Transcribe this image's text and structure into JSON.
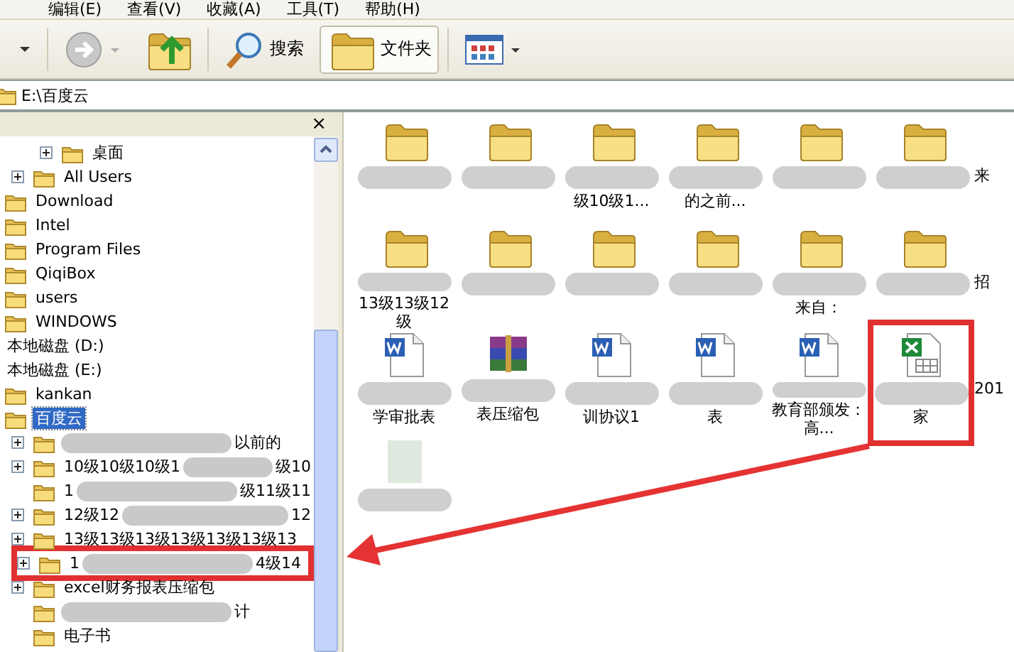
{
  "menu": [
    {
      "label": "编辑(E)"
    },
    {
      "label": "查看(V)"
    },
    {
      "label": "收藏(A)"
    },
    {
      "label": "工具(T)"
    },
    {
      "label": "帮助(H)"
    }
  ],
  "toolbar": [
    {
      "kind": "back"
    },
    {
      "kind": "forward",
      "disabled": true
    },
    {
      "kind": "up"
    },
    {
      "kind": "search",
      "label": "搜索",
      "selected": false
    },
    {
      "kind": "folders",
      "label": "文件夹",
      "selected": true
    },
    {
      "kind": "views"
    }
  ],
  "address": {
    "path": "E:\\百度云"
  },
  "tree": {
    "close": "×",
    "items": [
      {
        "children": [
          {
            "children": [
              {
                "children": [
                  {
                    "label": "桌面",
                    "kind": "folder",
                    "expanded": false
                  }
                ]
              },
              {
                "label": "All Users",
                "kind": "folder",
                "expanded": false
              }
            ]
          },
          {
            "label": "Download",
            "kind": "folder"
          },
          {
            "label": "Intel",
            "kind": "folder"
          },
          {
            "label": "Program Files",
            "kind": "folder"
          },
          {
            "label": "QiqiBox",
            "kind": "folder"
          },
          {
            "label": "users",
            "kind": "folder"
          },
          {
            "label": "WINDOWS",
            "kind": "folder"
          }
        ]
      },
      {
        "label": "本地磁盘 (D:)"
      },
      {
        "label": "本地磁盘 (E:)",
        "children": [
          {
            "label": "kankan",
            "kind": "folder",
            "selected": false
          },
          {
            "label": "百度云",
            "kind": "folder",
            "selected": true,
            "children": [
              {
                "kind": "folder",
                "expanded": false,
                "blurred": true,
                "tail": "以前的",
                "selected": false
              },
              {
                "kind": "folder",
                "expanded": false,
                "label": "10级10级10级1",
                "blurred": true,
                "tail": "级10",
                "selected": false
              },
              {
                "kind": "folder",
                "label": "1",
                "blurred": true,
                "tail": "级11级11",
                "selected": false
              },
              {
                "kind": "folder",
                "expanded": false,
                "label": "12级12",
                "blurred": true,
                "tail": "12",
                "selected": false
              },
              {
                "kind": "folder",
                "expanded": false,
                "label": "13级13级13级13级13级13级13",
                "selected": false
              },
              {
                "kind": "folder",
                "expanded": false,
                "label": "1",
                "blurred": true,
                "tail": "4级14",
                "highlighted": true,
                "selected": false
              },
              {
                "kind": "folder",
                "expanded": false,
                "label": "excel财务报表压缩包",
                "selected": false
              },
              {
                "kind": "folder",
                "blurred": true,
                "tail": "计",
                "selected": false
              },
              {
                "kind": "folder",
                "label": "电子书",
                "selected": false
              }
            ]
          }
        ]
      }
    ]
  },
  "files": [
    {
      "kind": "folder",
      "blurred": true
    },
    {
      "kind": "folder",
      "blurred": true
    },
    {
      "kind": "folder",
      "blurred": true,
      "label": "级10级1..."
    },
    {
      "kind": "folder",
      "blurred": true,
      "label": "的之前..."
    },
    {
      "kind": "folder",
      "blurred": true
    },
    {
      "kind": "folder",
      "blurred": true
    },
    {
      "kind": "partial",
      "label": "来"
    },
    {
      "kind": "folder",
      "blurred": true,
      "label": "13级13级12 级"
    },
    {
      "kind": "folder",
      "blurred": true
    },
    {
      "kind": "folder",
      "blurred": true
    },
    {
      "kind": "folder",
      "blurred": true
    },
    {
      "kind": "folder",
      "blurred": true,
      "label": "来自："
    },
    {
      "kind": "folder",
      "blurred": true
    },
    {
      "kind": "partial",
      "label": "招"
    },
    {
      "kind": "word",
      "blurred": true,
      "label": "学审批表"
    },
    {
      "kind": "rar",
      "blurred": true,
      "label": "表压缩包"
    },
    {
      "kind": "word",
      "blurred": true,
      "label": "训协议1"
    },
    {
      "kind": "word",
      "blurred": true,
      "label": "表"
    },
    {
      "kind": "word",
      "blurred": true,
      "label": "教育部颁发：高..."
    },
    {
      "kind": "excel",
      "blurred": true,
      "label": "家",
      "highlighted": true
    },
    {
      "kind": "partial",
      "label": "201"
    },
    {
      "kind": "unknown",
      "blurred": true
    }
  ],
  "annotation": {
    "arrow": true
  }
}
